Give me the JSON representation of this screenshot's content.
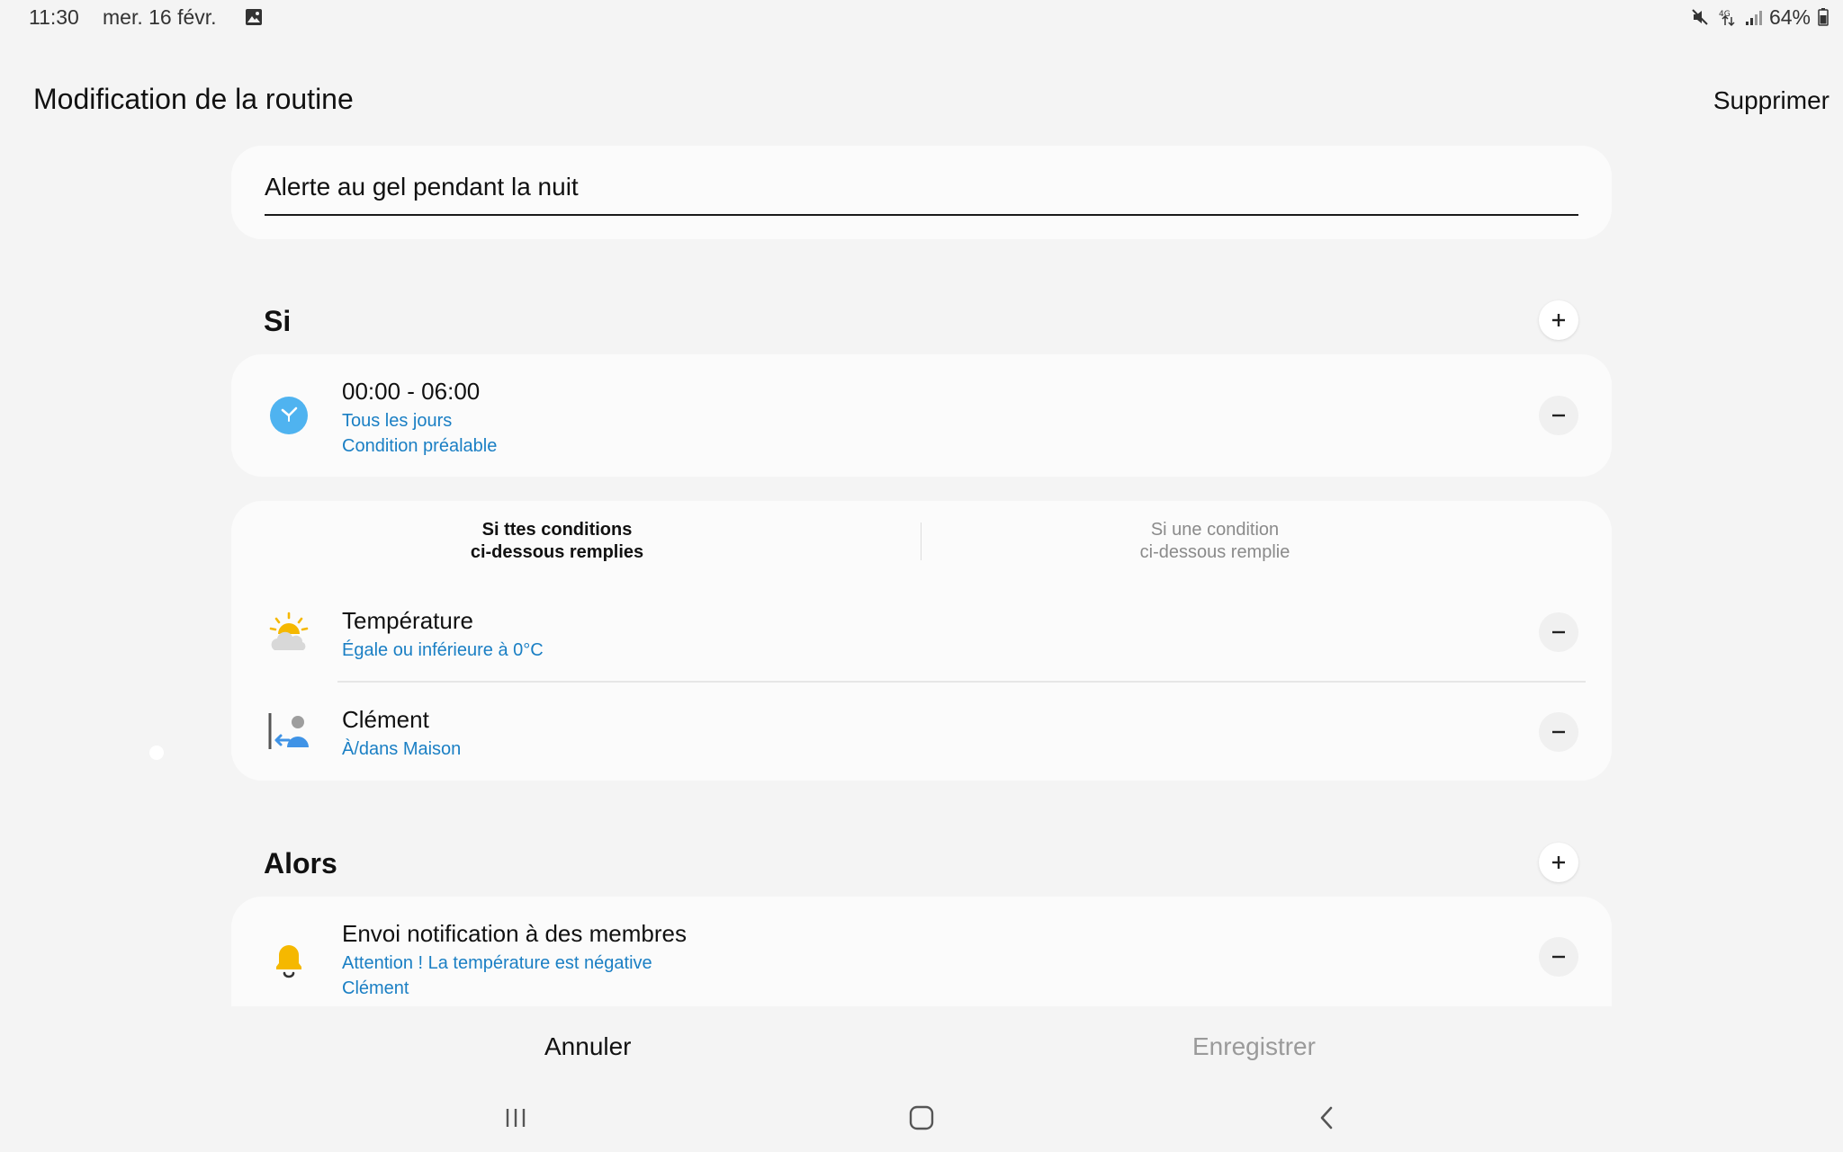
{
  "status_bar": {
    "time": "11:30",
    "date": "mer. 16 févr.",
    "battery": "64%",
    "icons": [
      "gallery-icon",
      "mute-icon",
      "4g-data-icon",
      "signal-icon",
      "battery-icon"
    ]
  },
  "header": {
    "title": "Modification de la routine",
    "delete_label": "Supprimer"
  },
  "routine_name": {
    "value": "Alerte au gel pendant la nuit"
  },
  "if_section": {
    "title": "Si",
    "time_condition": {
      "title": "00:00 - 06:00",
      "line1": "Tous les jours",
      "line2": "Condition préalable",
      "icon": "clock-icon"
    },
    "mode_all": "Si ttes conditions\nci-dessous remplies",
    "mode_any": "Si une condition\nci-dessous remplie",
    "conditions": [
      {
        "title": "Température",
        "subtitle": "Égale ou inférieure à 0°C",
        "icon": "weather-icon"
      },
      {
        "title": "Clément",
        "subtitle": "À/dans Maison",
        "icon": "person-arrival-icon"
      }
    ]
  },
  "then_section": {
    "title": "Alors",
    "action": {
      "title": "Envoi notification à des membres",
      "line1": "Attention ! La température est négative",
      "line2": "Clément",
      "icon": "bell-icon"
    }
  },
  "footer": {
    "cancel_label": "Annuler",
    "save_label": "Enregistrer"
  },
  "colors": {
    "accent_blue": "#1a7fc4",
    "clock_blue": "#4fb3f0",
    "bell_yellow": "#f5b800",
    "disabled_gray": "#9a9a9a"
  }
}
